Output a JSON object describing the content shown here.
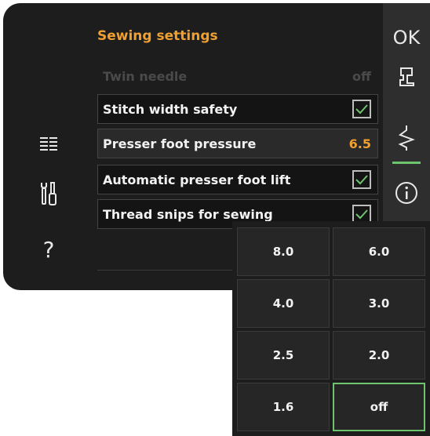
{
  "screen": {
    "title": "Sewing settings",
    "ok_label": "OK",
    "help_label": "?"
  },
  "settings": [
    {
      "label": "Twin needle",
      "value": "off",
      "state": "disabled"
    },
    {
      "label": "Stitch width safety",
      "checked": true
    },
    {
      "label": "Presser foot pressure",
      "value": "6.5",
      "state": "selected"
    },
    {
      "label": "Automatic presser foot lift",
      "checked": true
    },
    {
      "label": "Thread snips for sewing",
      "checked": true
    }
  ],
  "pressure_options": [
    "8.0",
    "6.0",
    "4.0",
    "3.0",
    "2.5",
    "2.0",
    "1.6",
    "off"
  ],
  "selected_option": "off",
  "icons": {
    "left": [
      "list-menu-icon",
      "tools-icon",
      "help-icon"
    ],
    "right": [
      "ok-button",
      "presser-foot-icon",
      "sewing-stitch-icon",
      "info-icon"
    ]
  },
  "colors": {
    "accent": "#f0a030",
    "check": "#6ec36e",
    "background": "#1d1d1d"
  }
}
